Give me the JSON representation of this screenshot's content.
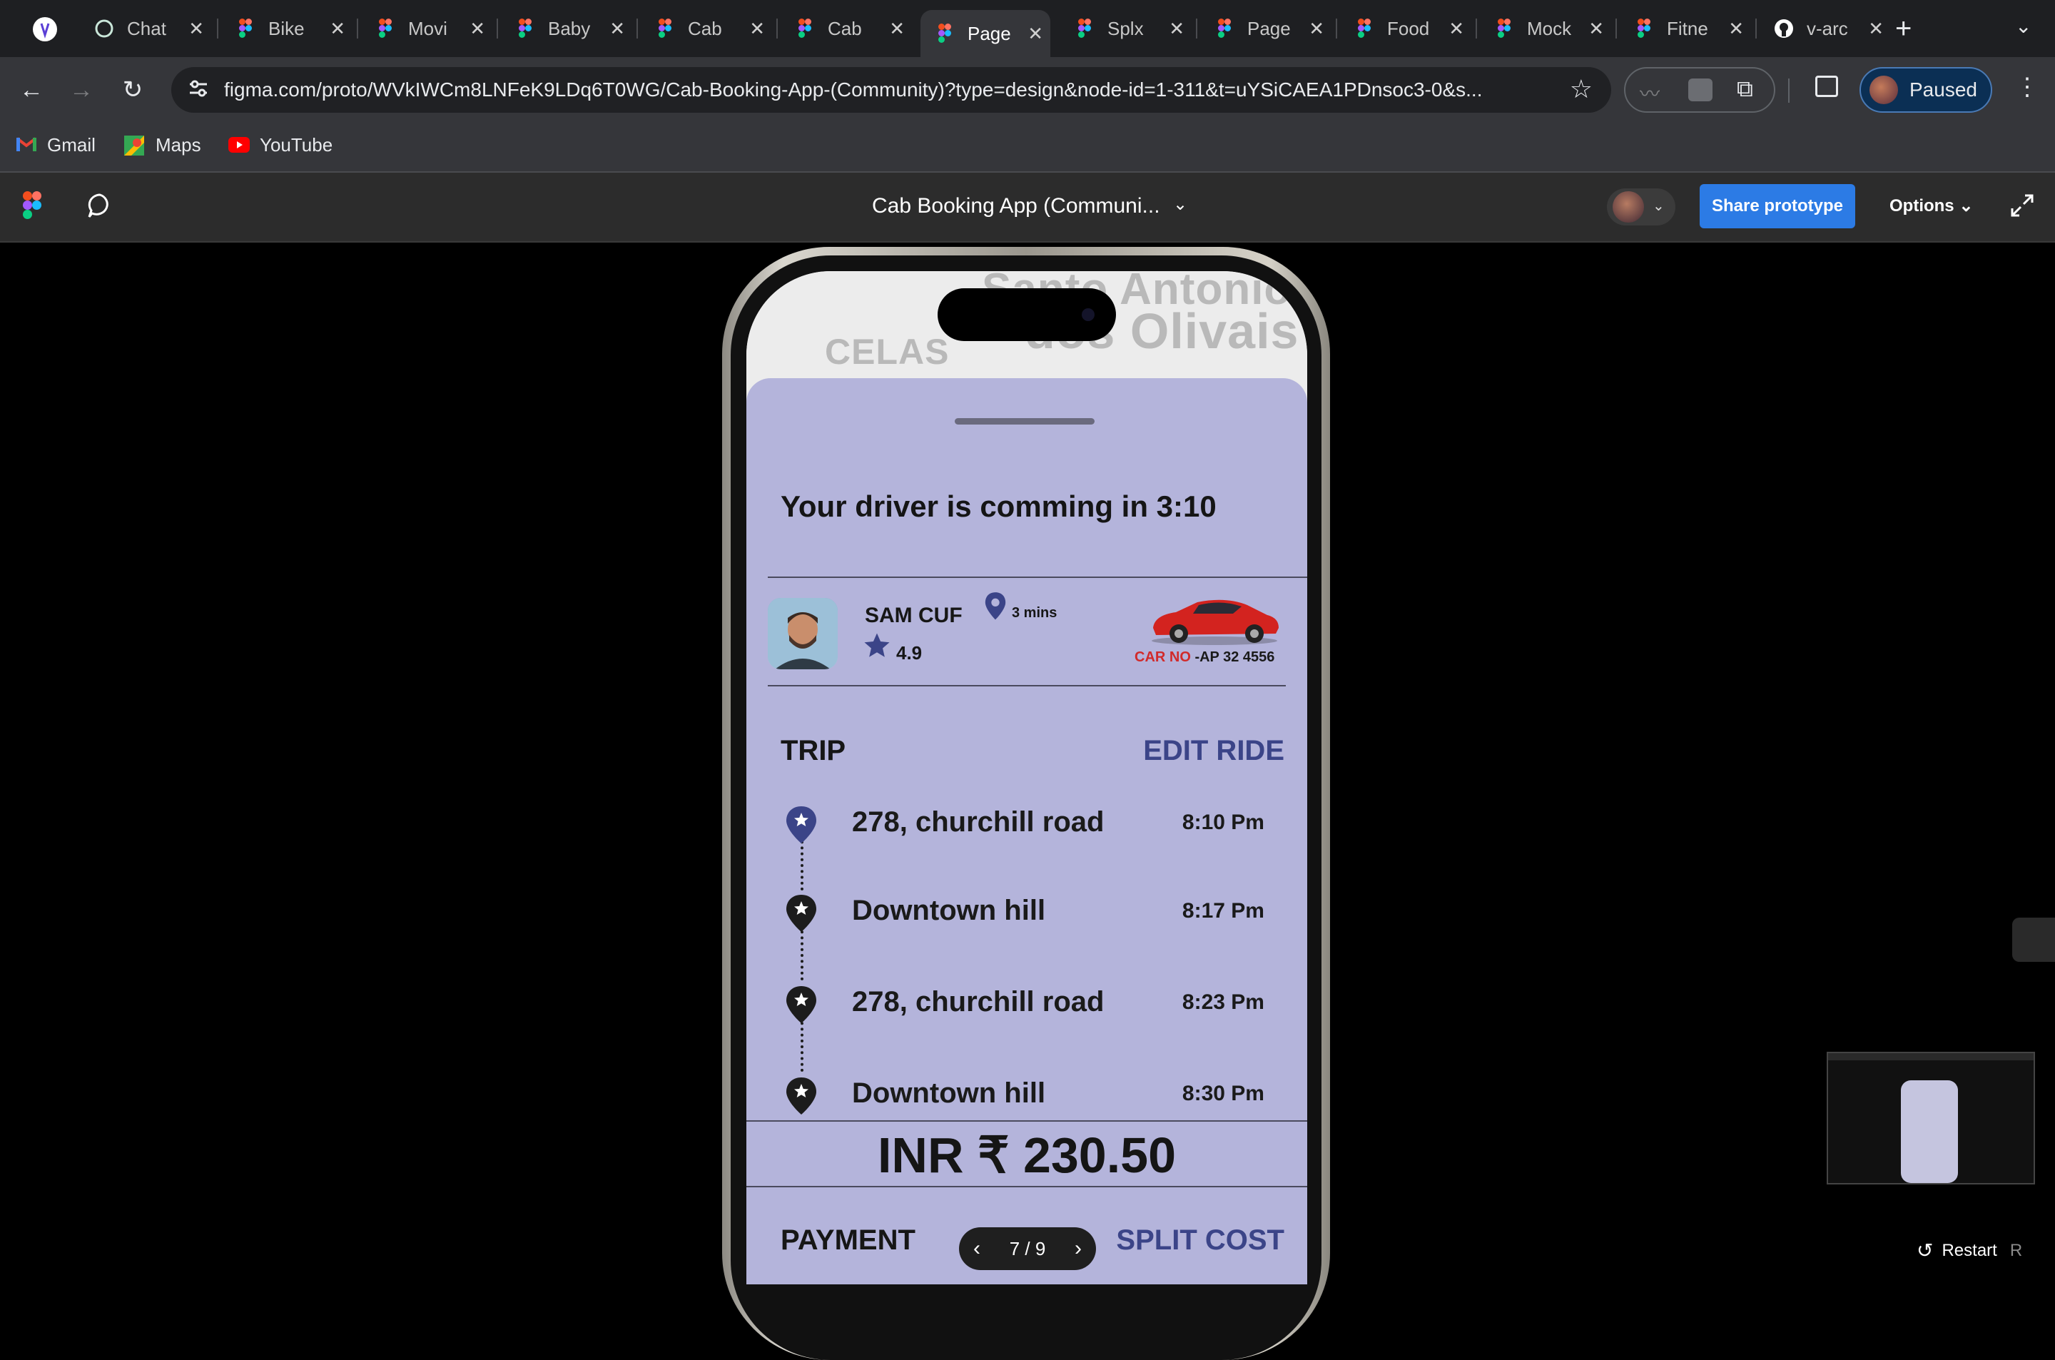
{
  "browser": {
    "tabs": [
      {
        "label": "Chat",
        "icon": "chatgpt-icon"
      },
      {
        "label": "Bike",
        "icon": "figma-icon"
      },
      {
        "label": "Movi",
        "icon": "figma-icon"
      },
      {
        "label": "Baby",
        "icon": "figma-icon"
      },
      {
        "label": "Cab",
        "icon": "figma-icon"
      },
      {
        "label": "Cab",
        "icon": "figma-icon"
      },
      {
        "label": "Page",
        "icon": "figma-icon",
        "active": true
      },
      {
        "label": "Splx",
        "icon": "figma-icon"
      },
      {
        "label": "Page",
        "icon": "figma-icon"
      },
      {
        "label": "Food",
        "icon": "figma-icon"
      },
      {
        "label": "Mock",
        "icon": "figma-icon"
      },
      {
        "label": "Fitne",
        "icon": "figma-icon"
      },
      {
        "label": "v-arc",
        "icon": "github-icon"
      }
    ],
    "url": "figma.com/proto/WVkIWCm8LNFeK9LDq6T0WG/Cab-Booking-App-(Community)?type=design&node-id=1-311&t=uYSiCAEA1PDnsoc3-0&s...",
    "profile_label": "Paused",
    "bookmarks": [
      "Gmail",
      "Maps",
      "YouTube"
    ]
  },
  "figma": {
    "file_title": "Cab Booking App (Communi...",
    "share_label": "Share prototype",
    "options_label": "Options",
    "pager": "7 / 9",
    "restart_label": "Restart",
    "restart_key": "R"
  },
  "app": {
    "map_labels": [
      "CELAS",
      "Santo Antonio",
      "dos Olivais"
    ],
    "headline": "Your  driver is comming in 3:10",
    "driver": {
      "name": "SAM CUF",
      "eta": "3 mins",
      "rating": "4.9",
      "car_no_label": "CAR NO",
      "car_no_value": " -AP 32 4556"
    },
    "trip_label": "TRIP",
    "edit_label": "EDIT RIDE",
    "stops": [
      {
        "address": "278, churchill road",
        "time": "8:10 Pm"
      },
      {
        "address": "Downtown hill",
        "time": "8:17 Pm"
      },
      {
        "address": "278, churchill road",
        "time": "8:23 Pm"
      },
      {
        "address": "Downtown hill",
        "time": "8:30 Pm"
      }
    ],
    "price": "INR ₹ 230.50",
    "payment_label": "PAYMENT",
    "split_label": "SPLIT COST"
  },
  "colors": {
    "sheet": "#b4b4db",
    "accent": "#3b4488",
    "share": "#2c7be5",
    "car_no_red": "#d12a2a"
  }
}
